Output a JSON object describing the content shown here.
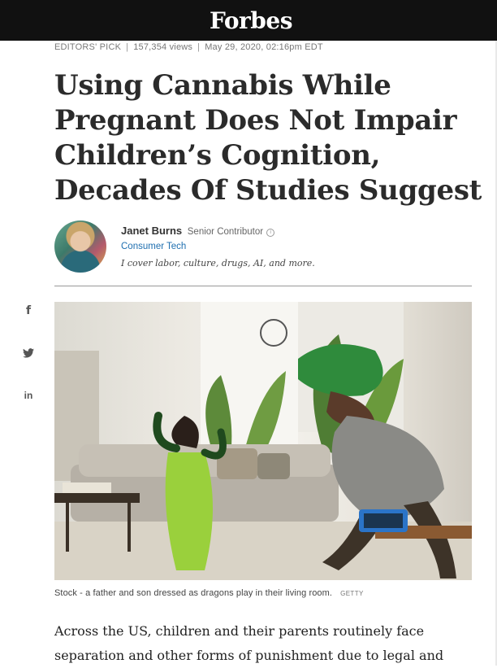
{
  "header": {
    "logo": "Forbes"
  },
  "meta": {
    "label": "EDITORS' PICK",
    "views": "157,354 views",
    "date": "May 29, 2020, 02:16pm EDT"
  },
  "article": {
    "headline": "Using Cannabis While Pregnant Does Not Impair Children’s Cognition, Decades Of Studies Suggest",
    "body_start": "Across the US, children and their parents routinely face separation and other forms of punishment due to legal and"
  },
  "author": {
    "name": "Janet Burns",
    "role": "Senior Contributor",
    "section": "Consumer Tech",
    "bio": "I cover labor, culture, drugs, AI, and more."
  },
  "share": {
    "facebook": "f",
    "twitter": "🐦",
    "linkedin": "in"
  },
  "image": {
    "caption": "Stock - a father and son dressed as dragons play in their living room.",
    "credit": "GETTY"
  },
  "colors": {
    "topbar": "#111111",
    "link": "#1f6fb0",
    "text": "#2b2b2b"
  }
}
